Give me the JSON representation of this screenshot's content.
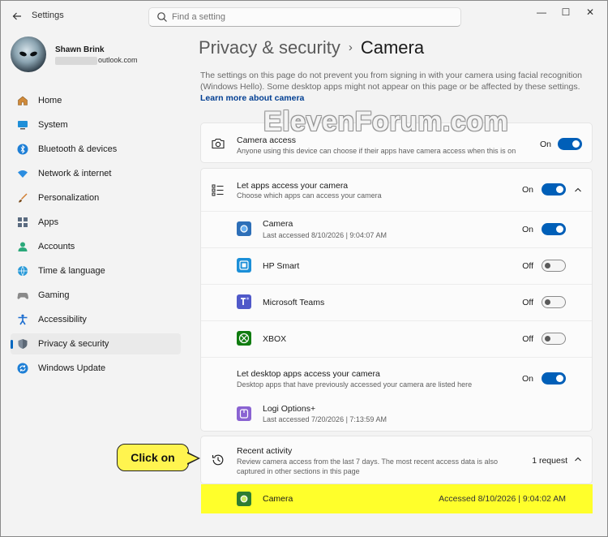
{
  "titlebar": {
    "app_title": "Settings",
    "search_placeholder": "Find a setting",
    "controls": {
      "minimize": "—",
      "maximize": "☐",
      "close": "✕"
    }
  },
  "profile": {
    "name": "Shawn Brink",
    "email_suffix": "outlook.com"
  },
  "sidebar": {
    "items": [
      {
        "label": "Home",
        "icon": "home-icon"
      },
      {
        "label": "System",
        "icon": "system-icon"
      },
      {
        "label": "Bluetooth & devices",
        "icon": "bluetooth-icon"
      },
      {
        "label": "Network & internet",
        "icon": "wifi-icon"
      },
      {
        "label": "Personalization",
        "icon": "brush-icon"
      },
      {
        "label": "Apps",
        "icon": "apps-icon"
      },
      {
        "label": "Accounts",
        "icon": "accounts-icon"
      },
      {
        "label": "Time & language",
        "icon": "globe-icon"
      },
      {
        "label": "Gaming",
        "icon": "gamepad-icon"
      },
      {
        "label": "Accessibility",
        "icon": "accessibility-icon"
      },
      {
        "label": "Privacy & security",
        "icon": "shield-icon",
        "active": true
      },
      {
        "label": "Windows Update",
        "icon": "update-icon"
      }
    ]
  },
  "main": {
    "breadcrumb": {
      "parent": "Privacy & security",
      "separator": "›",
      "current": "Camera"
    },
    "intro": "The settings on this page do not prevent you from signing in with your camera using facial recognition (Windows Hello). Some desktop apps might not appear on this page or be affected by these settings.",
    "learn_more": "Learn more about camera",
    "camera_access": {
      "title": "Camera access",
      "desc": "Anyone using this device can choose if their apps have camera access when this is on",
      "state": "On"
    },
    "let_apps": {
      "title": "Let apps access your camera",
      "desc": "Choose which apps can access your camera",
      "state": "On",
      "apps": [
        {
          "name": "Camera",
          "desc": "Last accessed 8/10/2026  |  9:04:07 AM",
          "state": "On"
        },
        {
          "name": "HP Smart",
          "desc": "",
          "state": "Off"
        },
        {
          "name": "Microsoft Teams",
          "desc": "",
          "state": "Off"
        },
        {
          "name": "XBOX",
          "desc": "",
          "state": "Off"
        }
      ],
      "desktop": {
        "title": "Let desktop apps access your camera",
        "desc": "Desktop apps that have previously accessed your camera are listed here",
        "state": "On",
        "app": {
          "name": "Logi Options+",
          "desc": "Last accessed 7/20/2026  |  7:13:59 AM"
        }
      }
    },
    "recent_activity": {
      "title": "Recent activity",
      "desc_line1": "Review camera access from the last 7 days. The most recent access data is also",
      "desc_line2": "captured in other sections in this page",
      "count": "1 request",
      "entry": {
        "name": "Camera",
        "accessed": "Accessed 8/10/2026  |  9:04:02 AM"
      }
    }
  },
  "annotation": {
    "callout": "Click on"
  },
  "watermark": "ElevenForum.com",
  "colors": {
    "accent": "#005fb8",
    "highlight": "#ffff2b",
    "callout": "#fff44f"
  }
}
